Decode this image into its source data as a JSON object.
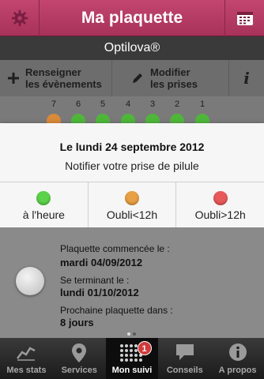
{
  "header": {
    "title": "Ma plaquette",
    "left_icon": "gear-icon",
    "right_icon": "calendar-icon"
  },
  "product": "Optilova®",
  "toolbar": {
    "events_line1": "Renseigner",
    "events_line2": "les évènements",
    "modify_line1": "Modifier",
    "modify_line2": "les prises",
    "info_icon": "info-icon"
  },
  "pill_days": [
    {
      "label": "7",
      "status": "late"
    },
    {
      "label": "6",
      "status": "on_time"
    },
    {
      "label": "5",
      "status": "on_time"
    },
    {
      "label": "4",
      "status": "on_time"
    },
    {
      "label": "3",
      "status": "on_time"
    },
    {
      "label": "2",
      "status": "on_time"
    },
    {
      "label": "1",
      "status": "on_time"
    }
  ],
  "modal": {
    "date": "Le lundi 24 septembre 2012",
    "prompt": "Notifier votre prise de pilule",
    "options": [
      {
        "label": "à l'heure",
        "color": "#5cd24a"
      },
      {
        "label": "Oubli<12h",
        "color": "#e8a044"
      },
      {
        "label": "Oubli>12h",
        "color": "#e85a5a"
      }
    ]
  },
  "plaquette": {
    "started_label": "Plaquette commencée le :",
    "started_value": "mardi 04/09/2012",
    "ends_label": "Se terminant le :",
    "ends_value": "lundi 01/10/2012",
    "next_label": "Prochaine plaquette dans :",
    "next_value": "8 jours"
  },
  "tabs": [
    {
      "label": "Mes stats",
      "icon": "stats-icon"
    },
    {
      "label": "Services",
      "icon": "map-pin-icon"
    },
    {
      "label": "Mon suivi",
      "icon": "pill-grid-icon",
      "badge": "1",
      "active": true
    },
    {
      "label": "Conseils",
      "icon": "chat-bubble-icon"
    },
    {
      "label": "A propos",
      "icon": "info-icon"
    }
  ],
  "colors": {
    "brand": "#b43a64",
    "on_time": "#4fb63a",
    "late": "#d98a3a"
  }
}
